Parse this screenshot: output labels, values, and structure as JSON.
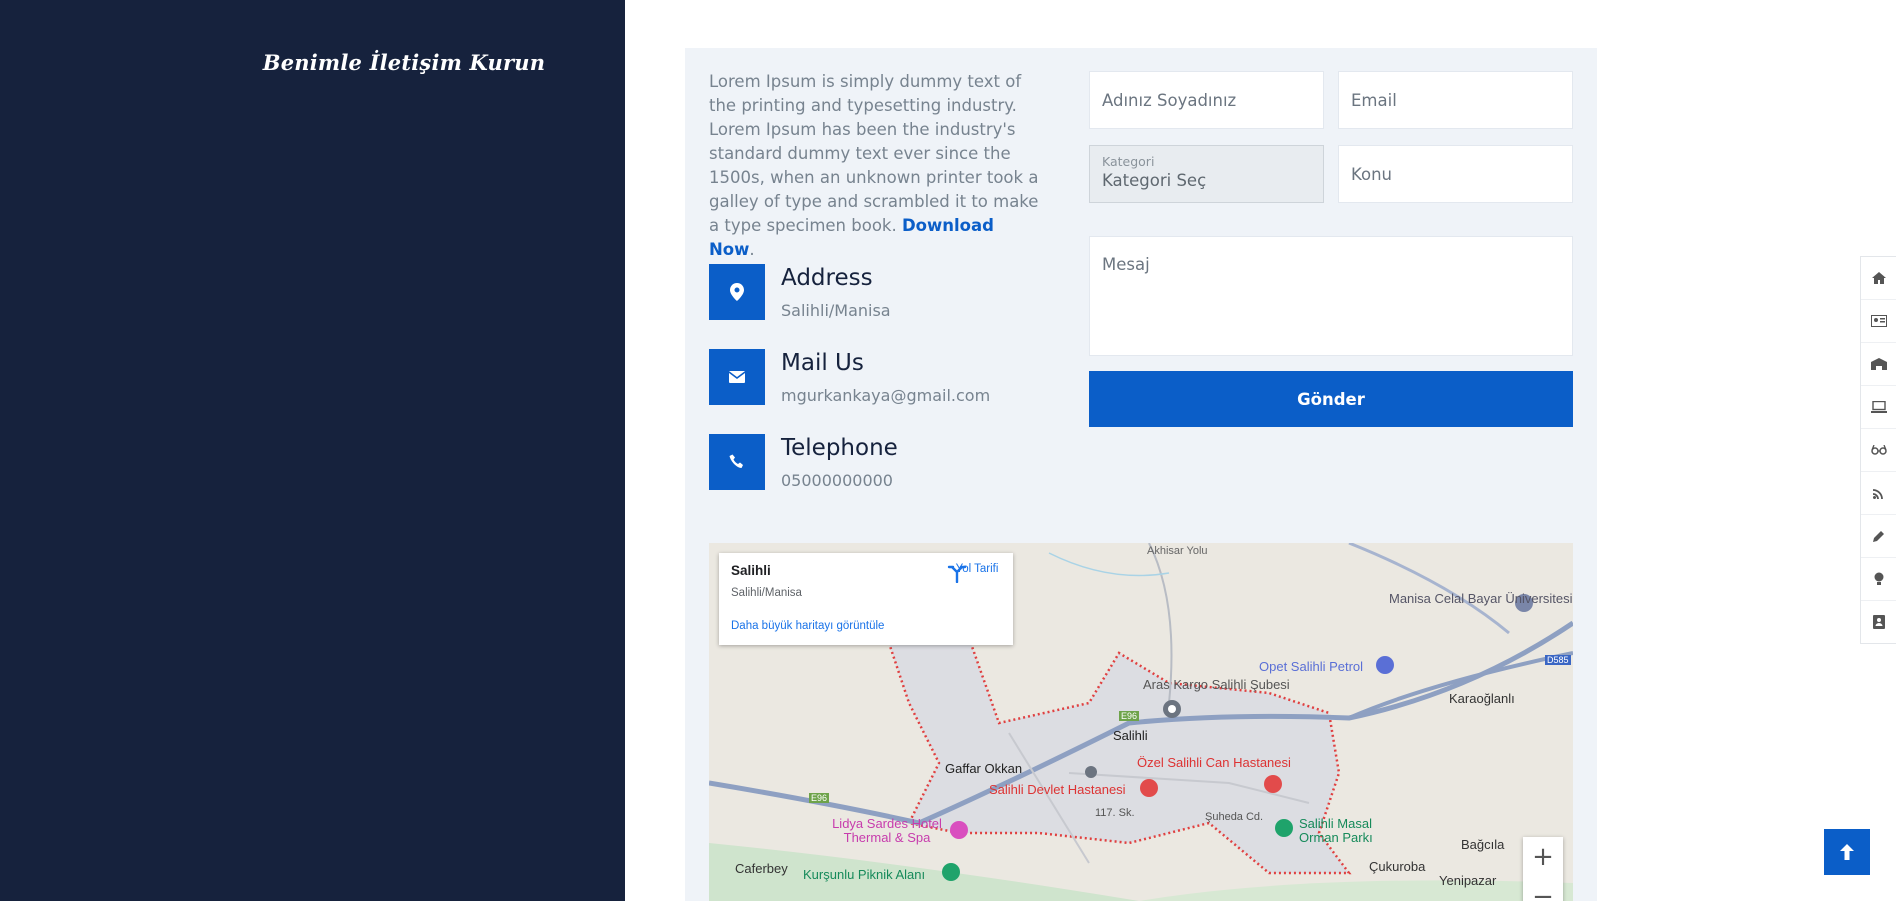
{
  "sidebar": {
    "title": "Benimle İletişim Kurun"
  },
  "intro": {
    "text": "Lorem Ipsum is simply dummy text of the printing and typesetting industry. Lorem Ipsum has been the industry's standard dummy text ever since the 1500s, when an unknown printer took a galley of type and scrambled it to make a type specimen book.",
    "link": "Download Now",
    "after": "."
  },
  "contact": [
    {
      "icon": "map-marker-icon",
      "title": "Address",
      "value": "Salihli/Manisa"
    },
    {
      "icon": "envelope-icon",
      "title": "Mail Us",
      "value": "mgurkankaya@gmail.com"
    },
    {
      "icon": "phone-icon",
      "title": "Telephone",
      "value": "05000000000"
    }
  ],
  "form": {
    "name_placeholder": "Adınız Soyadınız",
    "email_placeholder": "Email",
    "category_label": "Kategori",
    "category_value": "Kategori Seç",
    "subject_placeholder": "Konu",
    "message_placeholder": "Mesaj",
    "submit_label": "Gönder"
  },
  "map": {
    "place": "Salihli",
    "address": "Salihli/Manisa",
    "directions": "Yol Tarifi",
    "larger_map": "Daha büyük haritayı görüntüle",
    "zoom_in": "+",
    "zoom_out": "−",
    "labels": {
      "university": "Manisa Celal Bayar Üniversitesi, Salihli...",
      "opet": "Opet Salihli Petrol",
      "aras": "Aras Kargo Salihli Şubesi",
      "karaoglanli": "Karaoğlanlı",
      "salihli": "Salihli",
      "gaffar": "Gaffar Okkan",
      "ozel": "Özel Salihli Can Hastanesi",
      "devlet": "Salihli Devlet Hastanesi",
      "lidya": "Lidya Sardes Hotel Thermal & Spa",
      "masal": "Salihli Masal Orman Parkı",
      "caferbey": "Caferbey",
      "kursunlu": "Kurşunlu Piknik Alanı",
      "cukuroba": "Çukuroba",
      "yenipazar": "Yenipazar",
      "bagcila": "Bağcıla",
      "akhisar": "Akhisar Yolu",
      "sk117": "117. Sk.",
      "suheda": "Şuheda Cd.",
      "e96": "E96",
      "d585": "D585"
    }
  },
  "rail": [
    {
      "icon": "home-icon"
    },
    {
      "icon": "id-card-icon"
    },
    {
      "icon": "school-icon"
    },
    {
      "icon": "laptop-icon"
    },
    {
      "icon": "glasses-icon"
    },
    {
      "icon": "rss-icon"
    },
    {
      "icon": "pencil-icon"
    },
    {
      "icon": "lightbulb-icon"
    },
    {
      "icon": "contact-book-icon"
    }
  ],
  "colors": {
    "sidebar": "#16223d",
    "accent": "#0b5ec8",
    "card": "#eff3f8"
  }
}
